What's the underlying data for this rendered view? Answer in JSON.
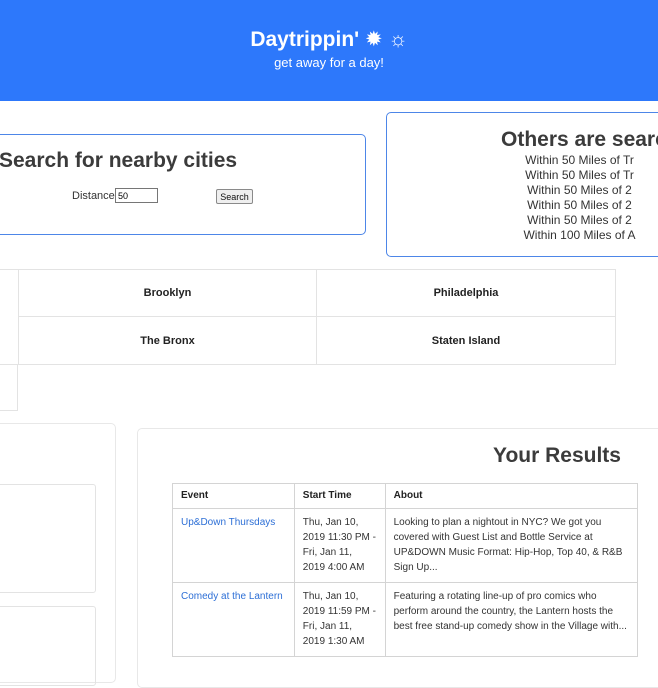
{
  "header": {
    "title": "Daytrippin'",
    "icons": "✹ ☼",
    "subtitle": "get away for a day!"
  },
  "search": {
    "heading": "Search for nearby cities",
    "distance_label": "Distance",
    "distance_value": "50",
    "button_label": "Search"
  },
  "others": {
    "heading": "Others are searching",
    "items": [
      "Within 50 Miles of Tr",
      "Within 50 Miles of Tr",
      "Within 50 Miles of 2",
      "Within 50 Miles of 2",
      "Within 50 Miles of 2",
      "Within 100 Miles of A"
    ]
  },
  "cities": [
    "Brooklyn",
    "Philadelphia",
    "The Bronx",
    "Staten Island"
  ],
  "results": {
    "heading": "Your Results",
    "columns": [
      "Event",
      "Start Time",
      "About"
    ],
    "rows": [
      {
        "event": "Up&Down Thursdays",
        "start": "Thu, Jan 10, 2019 11:30 PM - Fri, Jan 11, 2019 4:00 AM",
        "about": "Looking to plan a nightout in NYC? We got you covered with Guest List and Bottle Service at UP&DOWN Music Format: Hip-Hop, Top 40, & R&B Sign Up..."
      },
      {
        "event": "Comedy at the Lantern",
        "start": "Thu, Jan 10, 2019 11:59 PM - Fri, Jan 11, 2019 1:30 AM",
        "about": "Featuring a rotating line-up of pro comics who perform around the country, the Lantern hosts the best free stand-up comedy show in the Village with..."
      }
    ]
  }
}
